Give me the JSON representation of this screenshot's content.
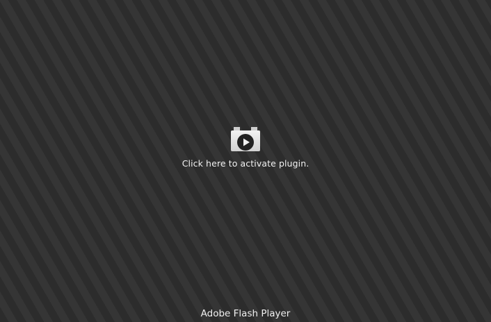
{
  "plugin": {
    "activate_label": "Click here to activate plugin.",
    "icon": "plugin-play-icon"
  },
  "footer": {
    "name": "Adobe Flash Player"
  }
}
